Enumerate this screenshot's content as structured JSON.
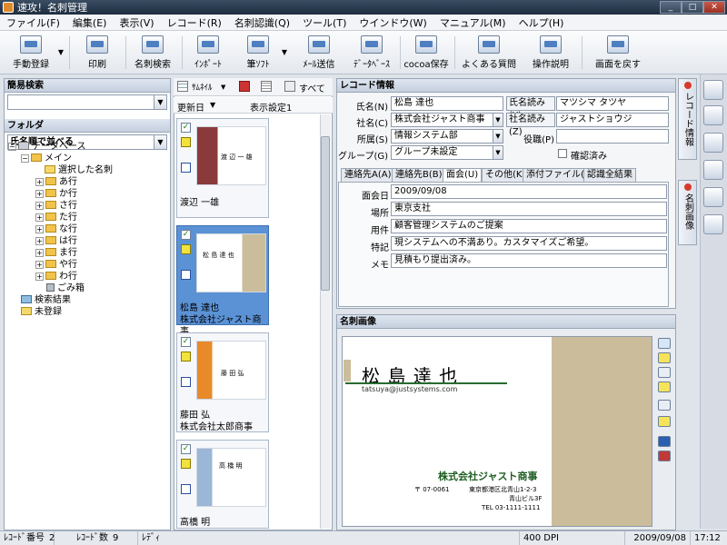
{
  "window": {
    "title": "速攻！名刺管理"
  },
  "menu": [
    "ファイル(F)",
    "編集(E)",
    "表示(V)",
    "レコード(R)",
    "名刺認識(Q)",
    "ツール(T)",
    "ウインドウ(W)",
    "マニュアル(M)",
    "ヘルプ(H)"
  ],
  "toolbar": {
    "manual": "手動登録",
    "print": "印刷",
    "search": "名刺検索",
    "import": "ｲﾝﾎﾟｰﾄ",
    "brush": "筆ｿﾌﾄ",
    "mail": "ﾒｰﾙ送信",
    "database": "ﾃﾞｰﾀﾍﾞｰｽ",
    "cocoa": "cocoa保存",
    "faq": "よくある質問",
    "howto": "操作説明",
    "back": "画面を戻す"
  },
  "left": {
    "quick_search": "簡易検索",
    "folder": "フォルダ",
    "sort_select": "氏名順で並べる",
    "tree": {
      "database": "データベース",
      "main": "メイン",
      "selected": "選択した名刺",
      "rows": [
        "あ行",
        "か行",
        "さ行",
        "た行",
        "な行",
        "は行",
        "ま行",
        "や行",
        "わ行"
      ],
      "trash": "ごみ箱",
      "search_results": "検索結果",
      "unregistered": "未登録"
    }
  },
  "cardlist": {
    "thumbnail": "ｻﾑﾈｲﾙ",
    "all": "すべて",
    "sort_col": "更新日",
    "display_setting": "表示設定1",
    "cards": [
      {
        "name": "渡辺 一雄",
        "company": "",
        "thumb_name": "渡 辺 一 雄"
      },
      {
        "name": "松島 達也",
        "company": "株式会社ジャスト商事",
        "thumb_name": "松 島 達 也"
      },
      {
        "name": "藤田 弘",
        "company": "株式会社太郎商事",
        "thumb_name": "藤 田 弘"
      },
      {
        "name": "高橋 明",
        "company": "",
        "thumb_name": "高 橋 明"
      }
    ]
  },
  "record": {
    "header": "レコード情報",
    "labels": {
      "name": "氏名(N)",
      "name_kana": "氏名読み(Y)",
      "company": "社名(C)",
      "company_kana": "社名読み(Z)",
      "dept": "所属(S)",
      "title": "役職(P)",
      "group": "グループ(G)",
      "confirmed": "確認済み"
    },
    "values": {
      "name": "松島 達也",
      "name_kana": "マツシマ タツヤ",
      "company": "株式会社ジャスト商事",
      "company_kana": "ジャストショウジ",
      "dept": "情報システム部",
      "title": "",
      "group": "グループ未設定"
    },
    "tabs": [
      "連絡先A(A)",
      "連絡先B(B)",
      "面会(U)",
      "その他(K)",
      "添付ファイル(X)",
      "認識全結果"
    ],
    "meeting": {
      "labels": [
        "面会日",
        "場所",
        "用件",
        "特記",
        "メモ"
      ],
      "values": [
        "2009/09/08",
        "東京支社",
        "顧客管理システムのご提案",
        "現システムへの不満あり。カスタマイズご希望。",
        "見積もり提出済み。"
      ]
    }
  },
  "card_image": {
    "header": "名刺画像",
    "name": "松 島 達 也",
    "email": "tatsuya@justsystems.com",
    "company": "株式会社ジャスト商事",
    "postal": "〒 07-0061",
    "address1": "東京都港区北青山1-2-3",
    "address2": "青山ビル3F",
    "tel": "TEL 03-1111-1111"
  },
  "side_tabs": {
    "record": "レコード情報",
    "image": "名刺画像"
  },
  "status": {
    "record_no": "ﾚｺｰﾄﾞ番号",
    "record_no_val": "2",
    "record_count": "ﾚｺｰﾄﾞ数",
    "record_count_val": "9",
    "ready": "ﾚﾃﾞｨ",
    "dpi": "400 DPI",
    "date": "2009/09/08",
    "time": "17:12"
  }
}
